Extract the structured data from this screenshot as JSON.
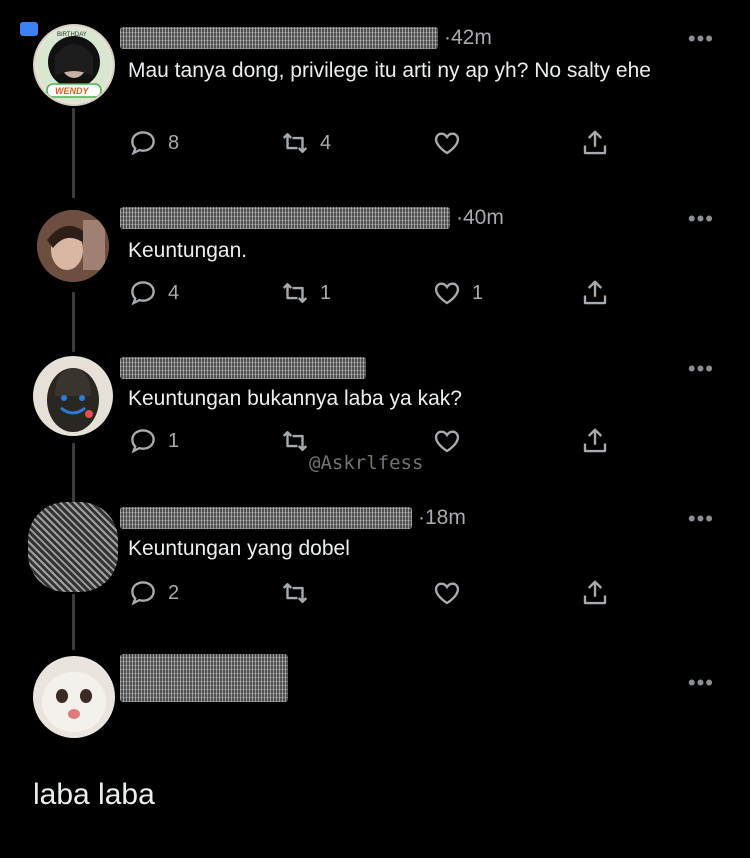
{
  "tweets": [
    {
      "time": "·42m",
      "text": "Mau tanya dong, privilege itu arti ny ap yh? No salty ehe",
      "replies": "8",
      "retweets": "4",
      "likes": ""
    },
    {
      "time": "·40m",
      "text": "Keuntungan.",
      "replies": "4",
      "retweets": "1",
      "likes": "1"
    },
    {
      "time": "",
      "text": "Keuntungan bukannya laba ya kak?",
      "replies": "1",
      "retweets": "",
      "likes": ""
    },
    {
      "time": "·18m",
      "text": "Keuntungan yang dobel",
      "replies": "2",
      "retweets": "",
      "likes": ""
    },
    {
      "time": "",
      "text": "",
      "replies": "",
      "retweets": "",
      "likes": ""
    }
  ],
  "avatar_badge": {
    "line1": "BIRTHDAY",
    "line2": "WENDY"
  },
  "more_label": "•••",
  "watermark": "@Askrlfess",
  "reply_text": "laba laba"
}
